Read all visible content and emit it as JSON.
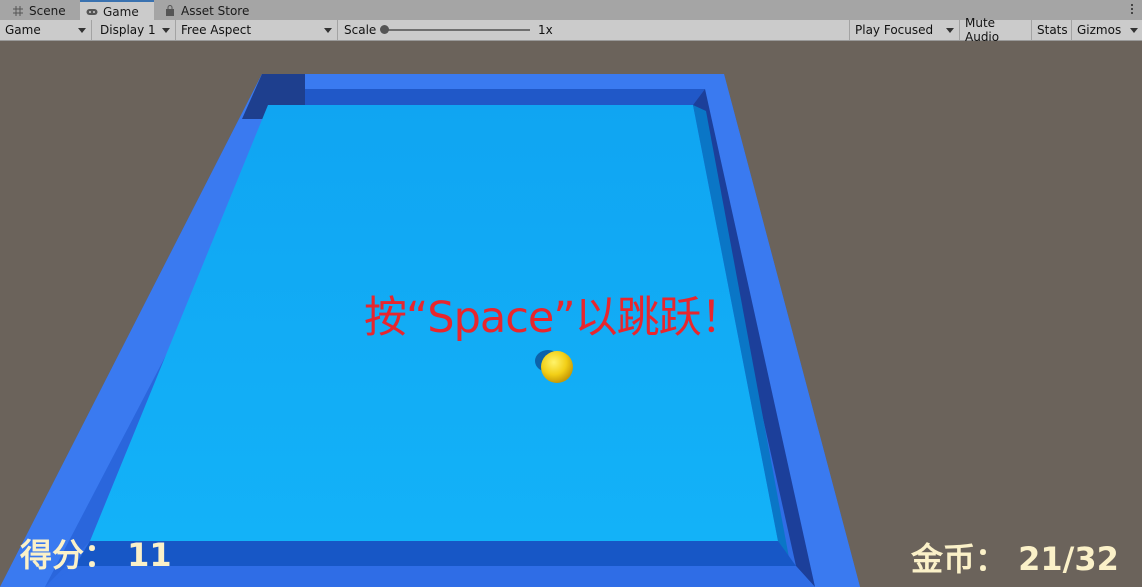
{
  "tabs": [
    {
      "label": "Scene",
      "icon": "grid-icon"
    },
    {
      "label": "Game",
      "icon": "gamepad-icon"
    },
    {
      "label": "Asset Store",
      "icon": "shopping-bag-icon"
    }
  ],
  "toolbar": {
    "view_select": "Game",
    "display_select": "Display 1",
    "aspect_select": "Free Aspect",
    "scale_label": "Scale",
    "scale_value": "1x",
    "play_mode_select": "Play Focused",
    "mute_audio": "Mute Audio",
    "stats": "Stats",
    "gizmos": "Gizmos"
  },
  "game": {
    "jump_hint": "按“Space”以跳跃！",
    "score_text": "得分： 11",
    "coins_text": "金币： 21/32",
    "colors": {
      "background": "#6b635b",
      "floor": "#0fa8f5",
      "wall": "#2f6ee8",
      "ball": "#f5d21a",
      "hint_text": "#e8262d",
      "hud_text": "#fbf1c8"
    }
  }
}
